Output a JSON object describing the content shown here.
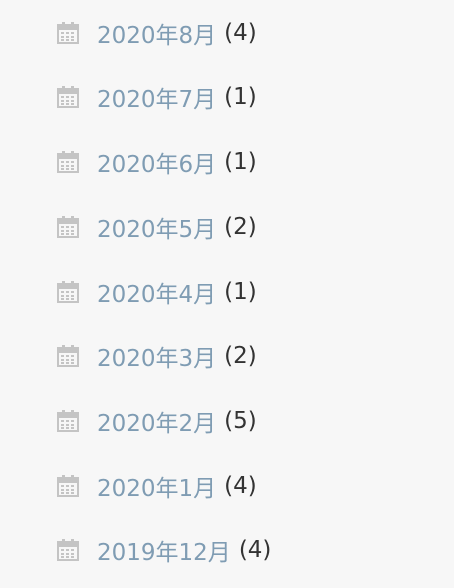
{
  "archive": {
    "items": [
      {
        "label": "2020年8月",
        "count": "(4)"
      },
      {
        "label": "2020年7月",
        "count": "(1)"
      },
      {
        "label": "2020年6月",
        "count": "(1)"
      },
      {
        "label": "2020年5月",
        "count": "(2)"
      },
      {
        "label": "2020年4月",
        "count": "(1)"
      },
      {
        "label": "2020年3月",
        "count": "(2)"
      },
      {
        "label": "2020年2月",
        "count": "(5)"
      },
      {
        "label": "2020年1月",
        "count": "(4)"
      },
      {
        "label": "2019年12月",
        "count": "(4)"
      }
    ],
    "icon": "calendar-icon",
    "colors": {
      "background": "#f7f7f7",
      "link": "#7f9cb3",
      "count": "#333333",
      "icon": "#c4c4c4"
    }
  }
}
